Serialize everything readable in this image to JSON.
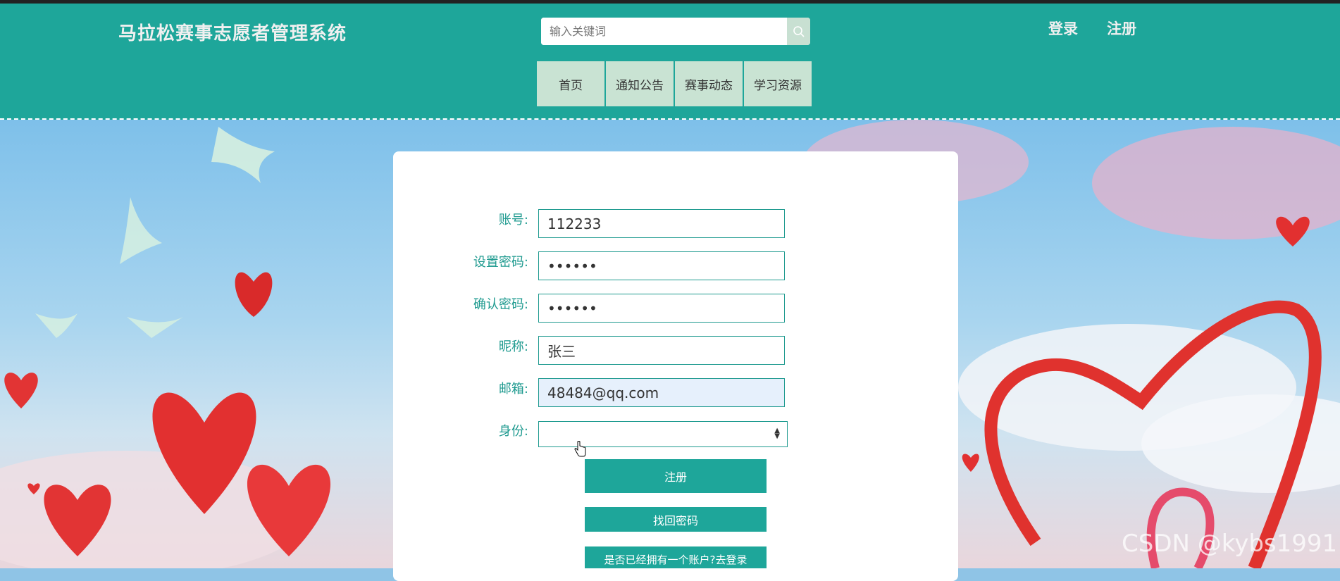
{
  "site": {
    "title": "马拉松赛事志愿者管理系统"
  },
  "search": {
    "placeholder": "输入关键词"
  },
  "auth": {
    "login": "登录",
    "register": "注册"
  },
  "nav": {
    "items": [
      "首页",
      "通知公告",
      "赛事动态",
      "学习资源"
    ]
  },
  "form": {
    "account": {
      "label": "账号:",
      "value": "112233"
    },
    "password": {
      "label": "设置密码:",
      "value": "••••••"
    },
    "confirm_password": {
      "label": "确认密码:",
      "value": "••••••"
    },
    "nickname": {
      "label": "昵称:",
      "value": "张三"
    },
    "email": {
      "label": "邮箱:",
      "value": "48484@qq.com"
    },
    "identity": {
      "label": "身份:",
      "value": ""
    },
    "register_button": "注册",
    "forgot_button": "找回密码",
    "login_link": "是否已经拥有一个账户?去登录"
  },
  "watermark": "CSDN @kybs1991",
  "colors": {
    "theme": "#1ea69a",
    "nav_bg": "#c9e3d3",
    "label": "#1e9a8f"
  }
}
